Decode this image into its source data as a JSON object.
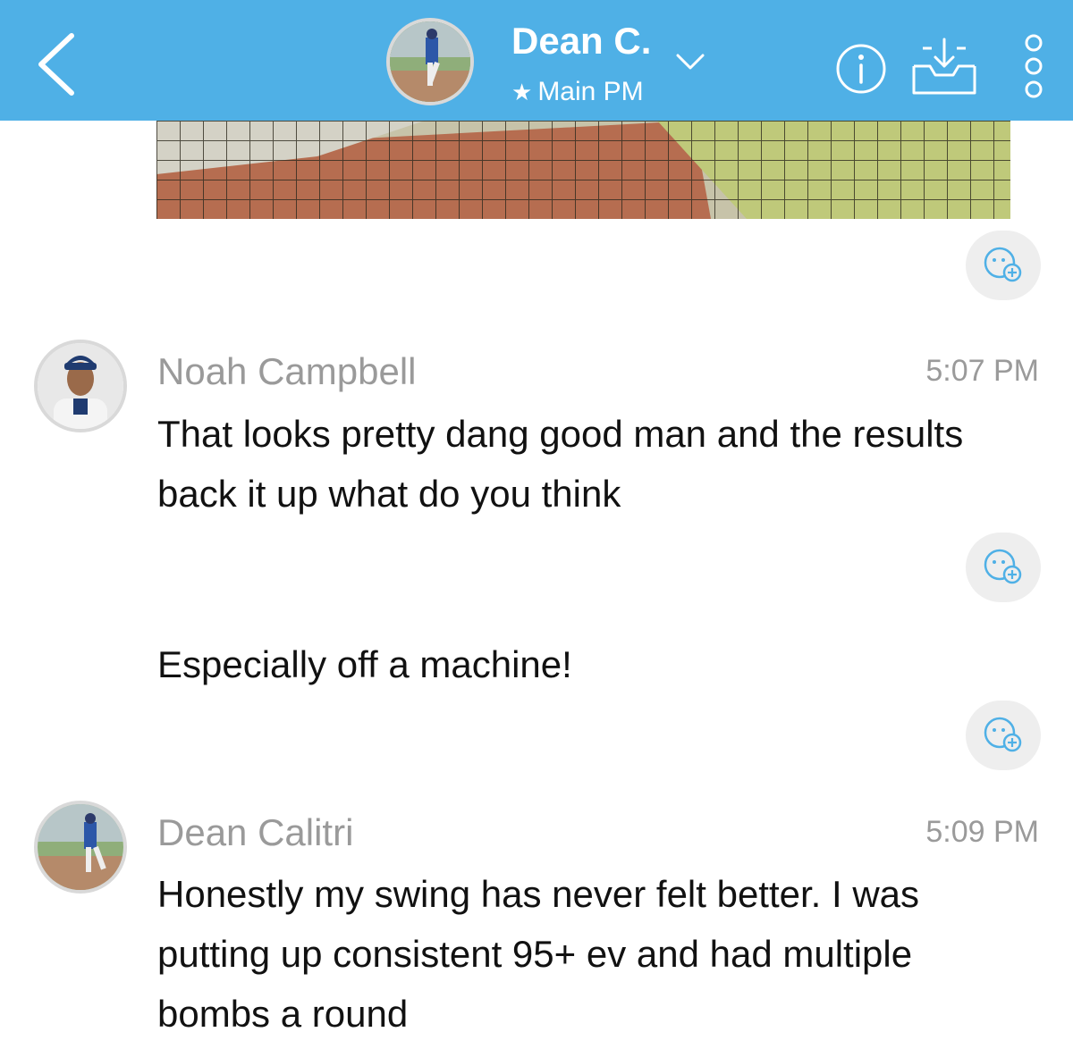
{
  "header": {
    "contact_name": "Dean C.",
    "subtitle": "Main PM",
    "background_color": "#4fb0e6",
    "icons": [
      "back-chevron-icon",
      "chevron-down-icon",
      "info-icon",
      "inbox-download-icon",
      "more-vertical-icon"
    ]
  },
  "messages": [
    {
      "sender": "Noah Campbell",
      "time": "5:07 PM",
      "texts": [
        "That looks pretty dang good man and the results back it up what do you think",
        "Especially off a machine!"
      ]
    },
    {
      "sender": "Dean Calitri",
      "time": "5:09 PM",
      "texts": [
        "Honestly my swing has never felt better. I was putting up consistent 95+ ev and had multiple bombs a round"
      ]
    }
  ]
}
